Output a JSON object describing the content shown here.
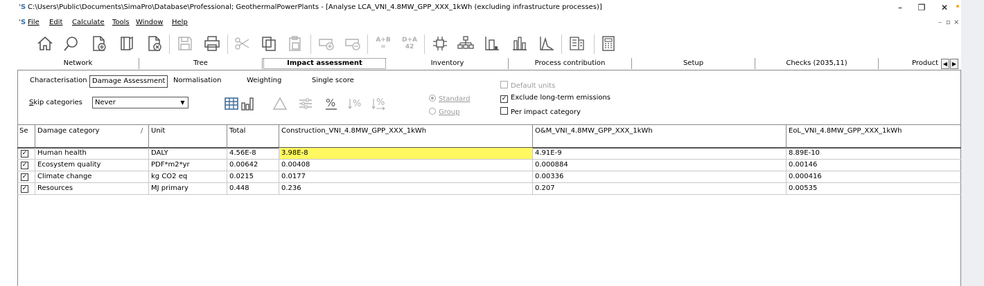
{
  "window": {
    "app_icon": "'S",
    "title": "C:\\Users\\Public\\Documents\\SimaPro\\Database\\Professional; GeothermalPowerPlants - [Analyse LCA_VNI_4.8MW_GPP_XXX_1kWh (excluding infrastructure processes)]",
    "minimize": "–",
    "maximize": "❐",
    "close": "✕"
  },
  "menu": {
    "app_icon": "'S",
    "items": [
      "File",
      "Edit",
      "Calculate",
      "Tools",
      "Window",
      "Help"
    ],
    "mdi_min": "–",
    "mdi_restore": "▫",
    "mdi_close": "×"
  },
  "toolbar": {
    "compare_label_top": "A+B",
    "compare_label_bottom": "=",
    "diff_label_top": "D+A",
    "diff_label_bottom": "42"
  },
  "tabs": [
    {
      "label": "Network"
    },
    {
      "label": "Tree"
    },
    {
      "label": "Impact assessment",
      "active": true
    },
    {
      "label": "Inventory"
    },
    {
      "label": "Process contribution"
    },
    {
      "label": "Setup"
    },
    {
      "label": "Checks (2035,11)"
    },
    {
      "label": "Product"
    }
  ],
  "subtabs": [
    "Characterisation",
    "Damage Assessment",
    "Normalisation",
    "Weighting",
    "Single score"
  ],
  "skip": {
    "label_prefix": "S",
    "label_rest": "kip categories",
    "value": "Never"
  },
  "options": {
    "standard": "Standard",
    "group": "Group",
    "default_units": "Default units",
    "exclude_long_term": "Exclude long-term emissions",
    "per_impact": "Per impact category"
  },
  "table": {
    "headers": [
      "Se",
      "Damage category",
      "/",
      "Unit",
      "Total",
      "Construction_VNI_4.8MW_GPP_XXX_1kWh",
      "O&M_VNI_4.8MW_GPP_XXX_1kWh",
      "EoL_VNI_4.8MW_GPP_XXX_1kWh"
    ],
    "rows": [
      {
        "checked": "✓",
        "category": "Human health",
        "unit": "DALY",
        "total": "4.56E-8",
        "construction": "3.98E-8",
        "om": "4.91E-9",
        "eol": "8.89E-10"
      },
      {
        "checked": "✓",
        "category": "Ecosystem quality",
        "unit": "PDF*m2*yr",
        "total": "0.00642",
        "construction": "0.00408",
        "om": "0.000884",
        "eol": "0.00146"
      },
      {
        "checked": "✓",
        "category": "Climate change",
        "unit": "kg CO2 eq",
        "total": "0.0215",
        "construction": "0.0177",
        "om": "0.00336",
        "eol": "0.000416"
      },
      {
        "checked": "✓",
        "category": "Resources",
        "unit": "MJ primary",
        "total": "0.448",
        "construction": "0.236",
        "om": "0.207",
        "eol": "0.00535"
      }
    ]
  },
  "colors": {
    "highlight": "#fff860",
    "accent": "#3a6ea5"
  }
}
